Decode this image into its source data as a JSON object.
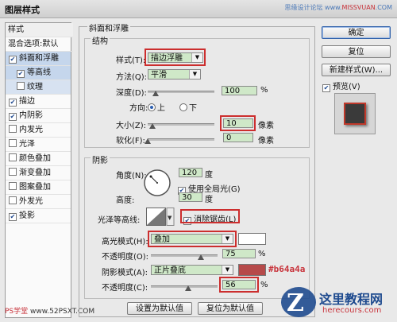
{
  "window": {
    "title": "图层样式",
    "watermark_prefix": "思缘设计论坛 www.",
    "watermark_brand": "MISSVUAN",
    "watermark_suffix": ".COM"
  },
  "sidebar": {
    "header": "样式",
    "items": [
      {
        "label": "混合选项:默认",
        "checkbox": false,
        "selected": false
      },
      {
        "label": "斜面和浮雕",
        "checkbox": true,
        "checked": true,
        "selected": true
      },
      {
        "label": "等高线",
        "checkbox": true,
        "checked": true,
        "selected": false,
        "indent": true
      },
      {
        "label": "纹理",
        "checkbox": true,
        "checked": false,
        "selected": false,
        "indent": true
      },
      {
        "label": "描边",
        "checkbox": true,
        "checked": true
      },
      {
        "label": "内阴影",
        "checkbox": true,
        "checked": true
      },
      {
        "label": "内发光",
        "checkbox": true,
        "checked": false
      },
      {
        "label": "光泽",
        "checkbox": true,
        "checked": false
      },
      {
        "label": "颜色叠加",
        "checkbox": true,
        "checked": false
      },
      {
        "label": "渐变叠加",
        "checkbox": true,
        "checked": false
      },
      {
        "label": "图案叠加",
        "checkbox": true,
        "checked": false
      },
      {
        "label": "外发光",
        "checkbox": true,
        "checked": false
      },
      {
        "label": "投影",
        "checkbox": true,
        "checked": true
      }
    ],
    "footer_prefix": "PS学堂  ",
    "footer_site": "www.52PSXT.COM"
  },
  "main": {
    "section_title": "斜面和浮雕",
    "structure": {
      "title": "结构",
      "style_label": "样式(T):",
      "style_value": "描边浮雕",
      "method_label": "方法(Q):",
      "method_value": "平滑",
      "depth_label": "深度(D):",
      "depth_value": "100",
      "depth_unit": "%",
      "depth_level": 0.12,
      "direction_label": "方向:",
      "direction_up": "上",
      "direction_down": "下",
      "size_label": "大小(Z):",
      "size_value": "10",
      "size_unit": "像素",
      "size_level": 0.07,
      "soften_label": "软化(F):",
      "soften_value": "0",
      "soften_unit": "像素",
      "soften_level": 0.0
    },
    "shading": {
      "title": "阴影",
      "angle_label": "角度(N):",
      "angle_value": "120",
      "angle_unit": "度",
      "global_light_label": "使用全局光(G)",
      "altitude_label": "高度:",
      "altitude_value": "30",
      "altitude_unit": "度",
      "gloss_label": "光泽等高线:",
      "antialias_label": "消除锯齿(L)",
      "highlight_mode_label": "高光模式(H):",
      "highlight_mode_value": "叠加",
      "highlight_color": "#ffffff",
      "highlight_opacity_label": "不透明度(O):",
      "highlight_opacity_value": "75",
      "highlight_opacity_unit": "%",
      "highlight_opacity_level": 0.75,
      "shadow_mode_label": "阴影模式(A):",
      "shadow_mode_value": "正片叠底",
      "shadow_color": "#b64a4a",
      "shadow_color_annotation": "#b64a4a",
      "shadow_opacity_label": "不透明度(C):",
      "shadow_opacity_value": "56",
      "shadow_opacity_unit": "%",
      "shadow_opacity_level": 0.56
    },
    "make_default": "设置为默认值",
    "reset_default": "复位为默认值"
  },
  "right": {
    "ok": "确定",
    "reset": "复位",
    "new_style": "新建样式(W)...",
    "preview_label": "预览(V)"
  },
  "brand": {
    "cn": "这里教程网",
    "url": "herecours.com"
  }
}
